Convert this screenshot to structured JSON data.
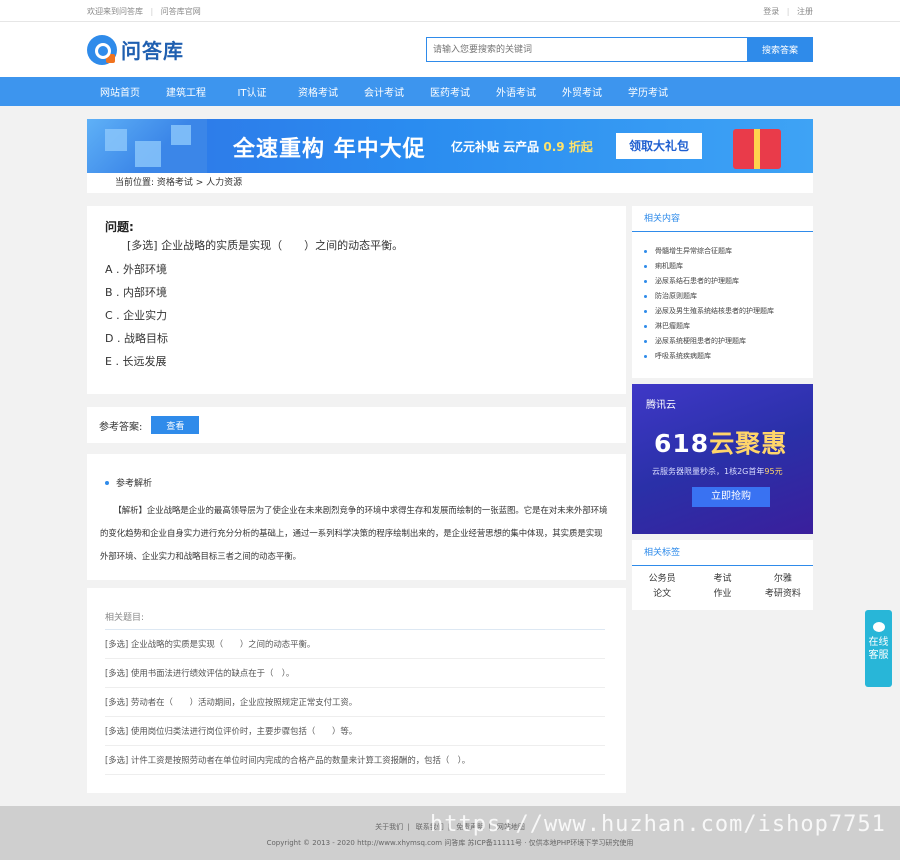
{
  "topbar": {
    "welcome": "欢迎来到问答库",
    "official": "问答库官网",
    "login": "登录",
    "register": "注册"
  },
  "header": {
    "logo_text": "问答库",
    "search_placeholder": "请输入您要搜索的关键词",
    "search_button": "搜索答案"
  },
  "nav": {
    "items": [
      "网站首页",
      "建筑工程",
      "IT认证",
      "资格考试",
      "会计考试",
      "医药考试",
      "外语考试",
      "外贸考试",
      "学历考试"
    ]
  },
  "banner": {
    "title": "全速重构 年中大促",
    "sub_prefix": "亿元补贴 云产品",
    "sub_highlight": "0.9 折起",
    "button": "领取大礼包"
  },
  "breadcrumb": {
    "text": "当前位置: 资格考试 > 人力资源"
  },
  "question": {
    "heading": "问题:",
    "text": "[多选] 企业战略的实质是实现（　　）之间的动态平衡。",
    "options": [
      "A . 外部环境",
      "B . 内部环境",
      "C . 企业实力",
      "D . 战略目标",
      "E . 长远发展"
    ]
  },
  "answer": {
    "label": "参考答案:",
    "button": "查看"
  },
  "analysis": {
    "heading": "参考解析",
    "body": "【解析】企业战略是企业的最高领导层为了使企业在未来剧烈竞争的环境中求得生存和发展而绘制的一张蓝图。它是在对未来外部环境的变化趋势和企业自身实力进行充分分析的基础上，通过一系列科学决策的程序绘制出来的，是企业经营思想的集中体现，其实质是实现外部环境、企业实力和战略目标三者之间的动态平衡。"
  },
  "related": {
    "heading": "相关题目:",
    "items": [
      "[多选] 企业战略的实质是实现（　　）之间的动态平衡。",
      "[多选] 使用书面法进行绩效评估的缺点在于（　）。",
      "[多选] 劳动者在（　　）活动期间，企业应按照规定正常支付工资。",
      "[多选] 使用岗位归类法进行岗位评价时，主要步骤包括（　　）等。",
      "[多选] 计件工资是按照劳动者在单位时间内完成的合格产品的数量来计算工资报酬的，包括（　）。"
    ]
  },
  "sidebar": {
    "related_title": "相关内容",
    "related_items": [
      "骨髓增生异常综合征题库",
      "痢机题库",
      "泌尿系结石患者的护理题库",
      "防治原则题库",
      "泌尿及男生殖系统结核患者的护理题库",
      "淋巴瘤题库",
      "泌尿系统梗阻患者的护理题库",
      "呼吸系统疾病题库"
    ],
    "ad": {
      "brand": "腾讯云",
      "big_num": "618",
      "big_text": "云聚惠",
      "desc_prefix": "云服务器限量秒杀，1核2G首年",
      "desc_price": "95元",
      "cta": "立即抢购"
    },
    "tags_title": "相关标签",
    "tags": [
      "公务员",
      "考试",
      "尔雅",
      "论文",
      "作业",
      "考研资料"
    ]
  },
  "float": {
    "label": "在线客服"
  },
  "footer": {
    "links": [
      "关于我们",
      "联系我们",
      "免责声明",
      "网站地图"
    ],
    "copyright": "Copyright © 2013 - 2020 http://www.xhymsq.com  问答库  苏ICP备11111号 · 仅供本地PHP环境下学习研究使用"
  },
  "watermark": "https://www.huzhan.com/ishop7751",
  "colors": {
    "accent": "#2f8bea",
    "nav": "#3d95ee",
    "float": "#28b6d8"
  }
}
